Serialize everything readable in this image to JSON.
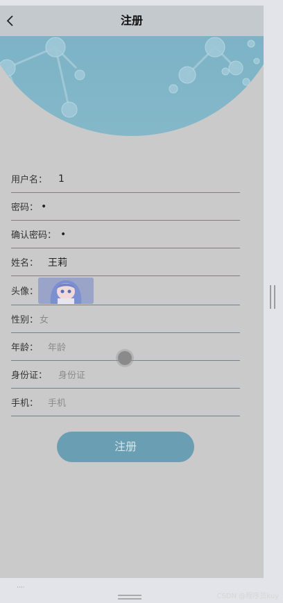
{
  "header": {
    "title": "注册",
    "back_icon": "chevron-left-icon"
  },
  "form": {
    "username": {
      "label": "用户名：",
      "value": "1"
    },
    "password": {
      "label": "密码：",
      "value": "•"
    },
    "confirm_password": {
      "label": "确认密码：",
      "value": "•"
    },
    "name": {
      "label": "姓名：",
      "value": "王莉"
    },
    "avatar": {
      "label": "头像："
    },
    "gender": {
      "label": "性别：",
      "value": "女"
    },
    "age": {
      "label": "年龄：",
      "placeholder": "年龄"
    },
    "id_card": {
      "label": "身份证：",
      "placeholder": "身份证"
    },
    "phone": {
      "label": "手机：",
      "placeholder": "手机"
    }
  },
  "submit_label": "注册",
  "bottom_hint": "····",
  "watermark": "CSDN @程序员kuy",
  "colors": {
    "page_bg": "#cacaca",
    "header_bg": "#c4c9cd",
    "banner": "#7cb2c6",
    "submit_bg": "#6a9eb2",
    "underline": "#5d89a7"
  }
}
